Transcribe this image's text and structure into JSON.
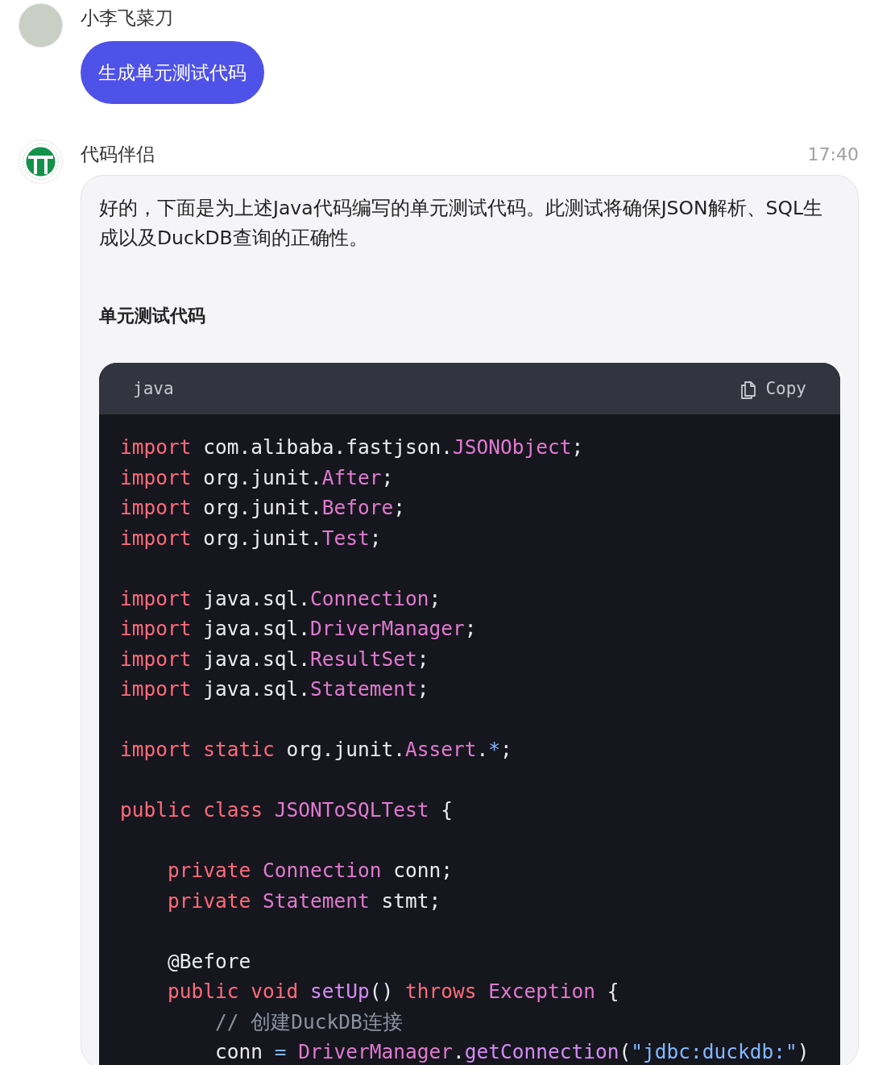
{
  "messages": [
    {
      "sender": "小李飞菜刀",
      "kind": "user",
      "text": "生成单元测试代码"
    },
    {
      "sender": "代码伴侣",
      "kind": "bot",
      "time": "17:40",
      "paragraph": "好的，下面是为上述Java代码编写的单元测试代码。此测试将确保JSON解析、SQL生成以及DuckDB查询的正确性。",
      "heading": "单元测试代码",
      "code": {
        "language": "java",
        "copy_label": "Copy",
        "groups": [
          [
            {
              "tokens": [
                {
                  "kind": "keyword",
                  "text": "import"
                },
                {
                  "kind": "plain",
                  "text": " com.alibaba.fastjson."
                },
                {
                  "kind": "type",
                  "text": "JSONObject"
                },
                {
                  "kind": "plain",
                  "text": ";"
                }
              ]
            },
            {
              "tokens": [
                {
                  "kind": "keyword",
                  "text": "import"
                },
                {
                  "kind": "plain",
                  "text": " org.junit."
                },
                {
                  "kind": "type",
                  "text": "After"
                },
                {
                  "kind": "plain",
                  "text": ";"
                }
              ]
            },
            {
              "tokens": [
                {
                  "kind": "keyword",
                  "text": "import"
                },
                {
                  "kind": "plain",
                  "text": " org.junit."
                },
                {
                  "kind": "type",
                  "text": "Before"
                },
                {
                  "kind": "plain",
                  "text": ";"
                }
              ]
            },
            {
              "tokens": [
                {
                  "kind": "keyword",
                  "text": "import"
                },
                {
                  "kind": "plain",
                  "text": " org.junit."
                },
                {
                  "kind": "type",
                  "text": "Test"
                },
                {
                  "kind": "plain",
                  "text": ";"
                }
              ]
            }
          ],
          [
            {
              "tokens": [
                {
                  "kind": "keyword",
                  "text": "import"
                },
                {
                  "kind": "plain",
                  "text": " java.sql."
                },
                {
                  "kind": "type",
                  "text": "Connection"
                },
                {
                  "kind": "plain",
                  "text": ";"
                }
              ]
            },
            {
              "tokens": [
                {
                  "kind": "keyword",
                  "text": "import"
                },
                {
                  "kind": "plain",
                  "text": " java.sql."
                },
                {
                  "kind": "type",
                  "text": "DriverManager"
                },
                {
                  "kind": "plain",
                  "text": ";"
                }
              ]
            },
            {
              "tokens": [
                {
                  "kind": "keyword",
                  "text": "import"
                },
                {
                  "kind": "plain",
                  "text": " java.sql."
                },
                {
                  "kind": "type",
                  "text": "ResultSet"
                },
                {
                  "kind": "plain",
                  "text": ";"
                }
              ]
            },
            {
              "tokens": [
                {
                  "kind": "keyword",
                  "text": "import"
                },
                {
                  "kind": "plain",
                  "text": " java.sql."
                },
                {
                  "kind": "type",
                  "text": "Statement"
                },
                {
                  "kind": "plain",
                  "text": ";"
                }
              ]
            }
          ],
          [
            {
              "tokens": [
                {
                  "kind": "keyword",
                  "text": "import static"
                },
                {
                  "kind": "plain",
                  "text": " org.junit."
                },
                {
                  "kind": "type",
                  "text": "Assert"
                },
                {
                  "kind": "plain",
                  "text": "."
                },
                {
                  "kind": "operator",
                  "text": "*"
                },
                {
                  "kind": "plain",
                  "text": ";"
                }
              ]
            }
          ],
          [
            {
              "tokens": [
                {
                  "kind": "keyword",
                  "text": "public class "
                },
                {
                  "kind": "type",
                  "text": "JSONToSQLTest"
                },
                {
                  "kind": "plain",
                  "text": " {"
                }
              ]
            }
          ],
          [
            {
              "tokens": [
                {
                  "kind": "keyword",
                  "text": "    private "
                },
                {
                  "kind": "type",
                  "text": "Connection"
                },
                {
                  "kind": "plain",
                  "text": " conn;"
                }
              ]
            },
            {
              "tokens": [
                {
                  "kind": "keyword",
                  "text": "    private "
                },
                {
                  "kind": "type",
                  "text": "Statement"
                },
                {
                  "kind": "plain",
                  "text": " stmt;"
                }
              ]
            }
          ],
          [
            {
              "tokens": [
                {
                  "kind": "plain",
                  "text": "    @Before"
                }
              ]
            },
            {
              "tokens": [
                {
                  "kind": "keyword",
                  "text": "    public void "
                },
                {
                  "kind": "function",
                  "text": "setUp"
                },
                {
                  "kind": "plain",
                  "text": "() "
                },
                {
                  "kind": "keyword",
                  "text": "throws "
                },
                {
                  "kind": "type",
                  "text": "Exception"
                },
                {
                  "kind": "plain",
                  "text": " {"
                }
              ]
            },
            {
              "tokens": [
                {
                  "kind": "comment",
                  "text": "        // 创建DuckDB连接"
                }
              ]
            },
            {
              "tokens": [
                {
                  "kind": "plain",
                  "text": "        conn "
                },
                {
                  "kind": "operator",
                  "text": "= "
                },
                {
                  "kind": "type",
                  "text": "DriverManager"
                },
                {
                  "kind": "plain",
                  "text": "."
                },
                {
                  "kind": "function",
                  "text": "getConnection"
                },
                {
                  "kind": "plain",
                  "text": "("
                },
                {
                  "kind": "string",
                  "text": "\"jdbc:duckdb:\""
                },
                {
                  "kind": "plain",
                  "text": ")"
                }
              ]
            }
          ]
        ]
      }
    }
  ]
}
